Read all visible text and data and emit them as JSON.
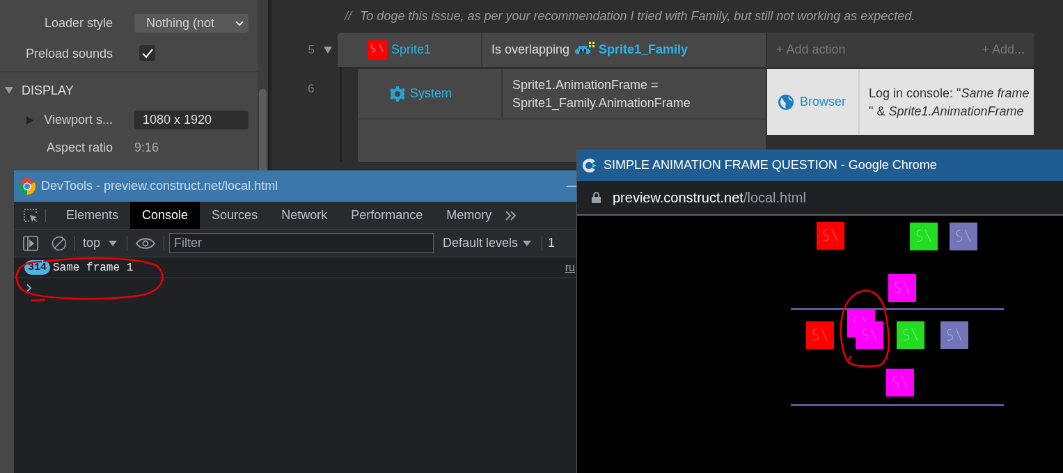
{
  "properties": {
    "rows": [
      {
        "kind": "dropdown",
        "label": "Loader style",
        "value": "Nothing (not"
      },
      {
        "kind": "checkbox",
        "label": "Preload sounds",
        "checked": true
      }
    ],
    "sections": [
      {
        "title": "DISPLAY",
        "expanded": true,
        "rows": [
          {
            "kind": "field",
            "label": "Viewport s...",
            "expanded": false,
            "value": "1080 x 1920"
          },
          {
            "kind": "text",
            "label": "Aspect ratio",
            "value": "9:16"
          }
        ]
      }
    ]
  },
  "event_sheet": {
    "comment_mark": "//",
    "comment": "To doge this issue, as per your recommendation I tried with Family, but still not working as expected.",
    "events": [
      {
        "number": "5",
        "expanded": true,
        "kind": "sprite",
        "object": "Sprite1",
        "condition": "Is overlapping",
        "condition_object": "Sprite1_Family",
        "add_action": "+ Add action",
        "add_more": "+ Add...",
        "children": [
          {
            "number": "6",
            "kind": "system",
            "object": "System",
            "condition": "Sprite1.AnimationFrame = Sprite1_Family.AnimationFrame",
            "actions": [
              {
                "kind": "browser",
                "object": "Browser",
                "text": "Log in console: \"*Same frame* \" & *Sprite1.AnimationFrame*"
              }
            ]
          }
        ]
      }
    ]
  },
  "devtools": {
    "title": "DevTools - preview.construct.net/local.html",
    "tabs": [
      {
        "label": "Elements",
        "selected": false
      },
      {
        "label": "Console",
        "selected": true
      },
      {
        "label": "Sources",
        "selected": false
      },
      {
        "label": "Network",
        "selected": false
      },
      {
        "label": "Performance",
        "selected": false
      },
      {
        "label": "Memory",
        "selected": false
      }
    ],
    "context": "top",
    "filter_placeholder": "Filter",
    "levels": "Default levels",
    "issues": "1",
    "messages": [
      {
        "count": "314",
        "text": "Same frame 1",
        "source": "ru"
      }
    ]
  },
  "chrome": {
    "title": "SIMPLE ANIMATION FRAME QUESTION - Google Chrome",
    "url_host": "preview.construct.net",
    "url_path": "/local.html"
  }
}
